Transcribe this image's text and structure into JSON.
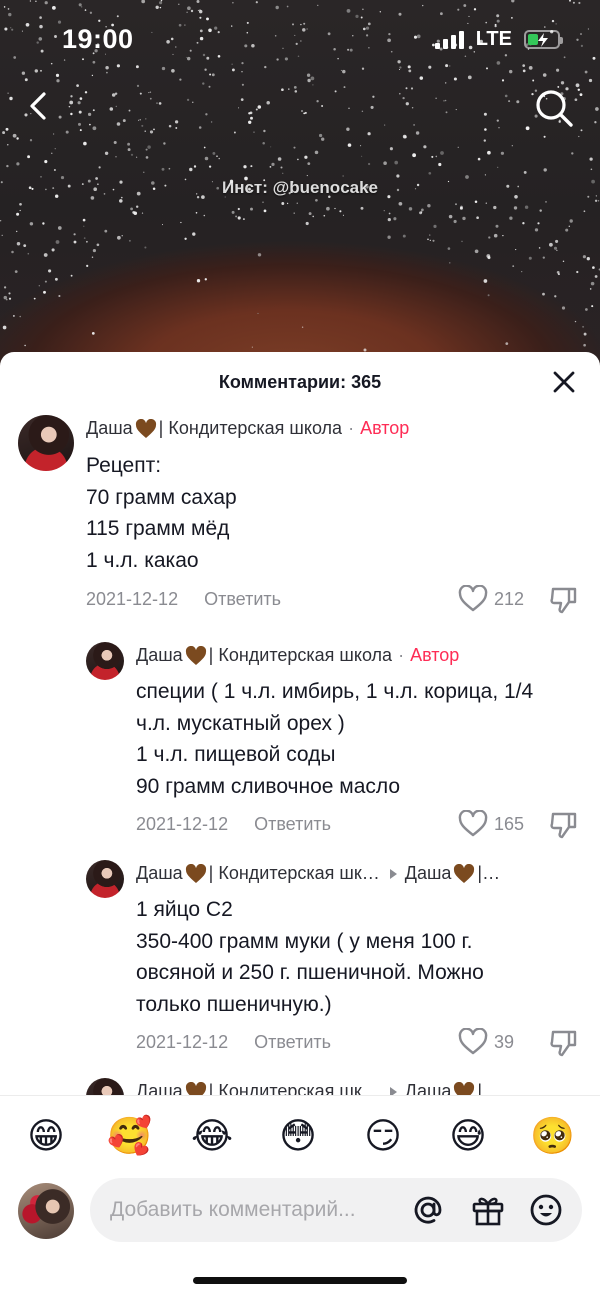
{
  "status_bar": {
    "time": "19:00",
    "network": "LTE"
  },
  "video": {
    "overlay_text": "Инст: @buenocake"
  },
  "comments_sheet": {
    "title": "Комментарии: 365",
    "comments": [
      {
        "author": "Даша",
        "author_suffix": "| Кондитерская школа",
        "tag": "Автор",
        "text": "Рецепт:\n70 грамм сахар\n115 грамм мёд\n1 ч.л. какао",
        "date": "2021-12-12",
        "reply_label": "Ответить",
        "likes": "212"
      },
      {
        "author": "Даша",
        "author_suffix": "| Кондитерская школа",
        "tag": "Автор",
        "text": "специи ( 1 ч.л. имбирь, 1 ч.л. корица, 1/4\nч.л. мускатный орех )\n1 ч.л. пищевой соды\n90 грамм сливочное масло",
        "date": "2021-12-12",
        "reply_label": "Ответить",
        "likes": "165"
      },
      {
        "author": "Даша",
        "author_suffix": "| Кондитерская шк…",
        "reply_to": "Даша",
        "reply_to_suffix": "|…",
        "text": "1 яйцо С2\n350-400 грамм муки ( у меня 100 г.\nовсяной и 250 г. пшеничной. Можно\nтолько пшеничную.)",
        "date": "2021-12-12",
        "reply_label": "Ответить",
        "likes": "39"
      },
      {
        "author": "Даша",
        "author_suffix": "| Кондитерская шк…",
        "reply_to": "Даша",
        "reply_to_suffix": "|…"
      }
    ]
  },
  "emoji_bar": [
    "😁",
    "🥰",
    "😂",
    "😳",
    "😏",
    "😅",
    "🥺"
  ],
  "input_bar": {
    "placeholder": "Добавить комментарий..."
  },
  "colors": {
    "accent": "#fe2c55",
    "muted_text": "#8a8b91",
    "heart_brown": "#7b4a1f"
  }
}
